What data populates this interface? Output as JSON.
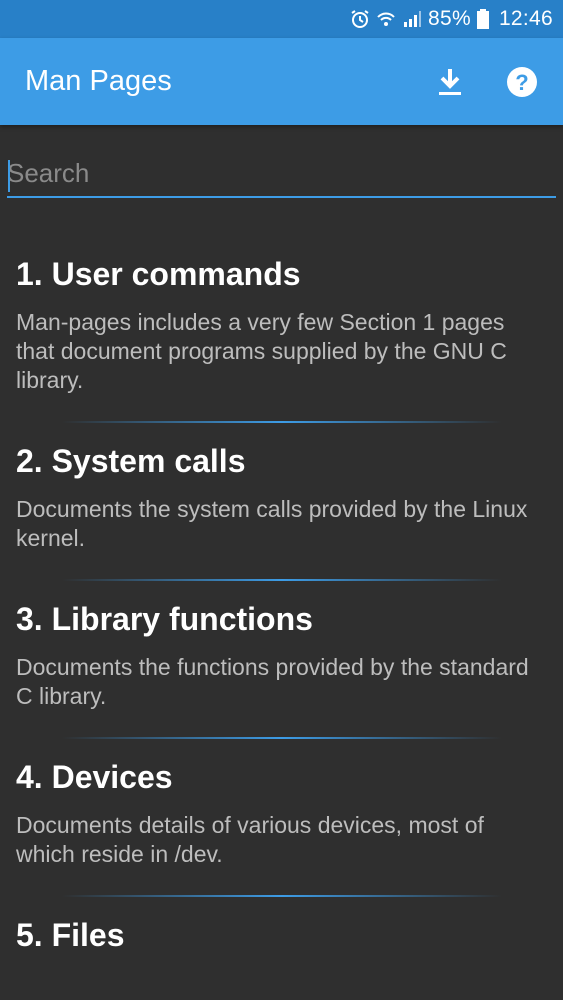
{
  "status_bar": {
    "battery": "85%",
    "time": "12:46",
    "icons": [
      "alarm-icon",
      "wifi-icon",
      "signal-icon",
      "battery-icon"
    ]
  },
  "app_bar": {
    "title": "Man Pages",
    "icons": [
      "download-icon",
      "help-icon"
    ],
    "color": "#3d9ce6"
  },
  "search": {
    "placeholder": "Search",
    "value": ""
  },
  "sections": [
    {
      "title": "1. User commands",
      "description": "Man-pages includes a very few Section 1 pages that document programs supplied by the GNU C library."
    },
    {
      "title": "2. System calls",
      "description": "Documents the system calls provided by the Linux kernel."
    },
    {
      "title": "3. Library functions",
      "description": "Documents the functions provided by the standard C library."
    },
    {
      "title": "4. Devices",
      "description": "Documents details of various devices, most of which reside in /dev."
    },
    {
      "title": "5. Files",
      "description": ""
    }
  ]
}
